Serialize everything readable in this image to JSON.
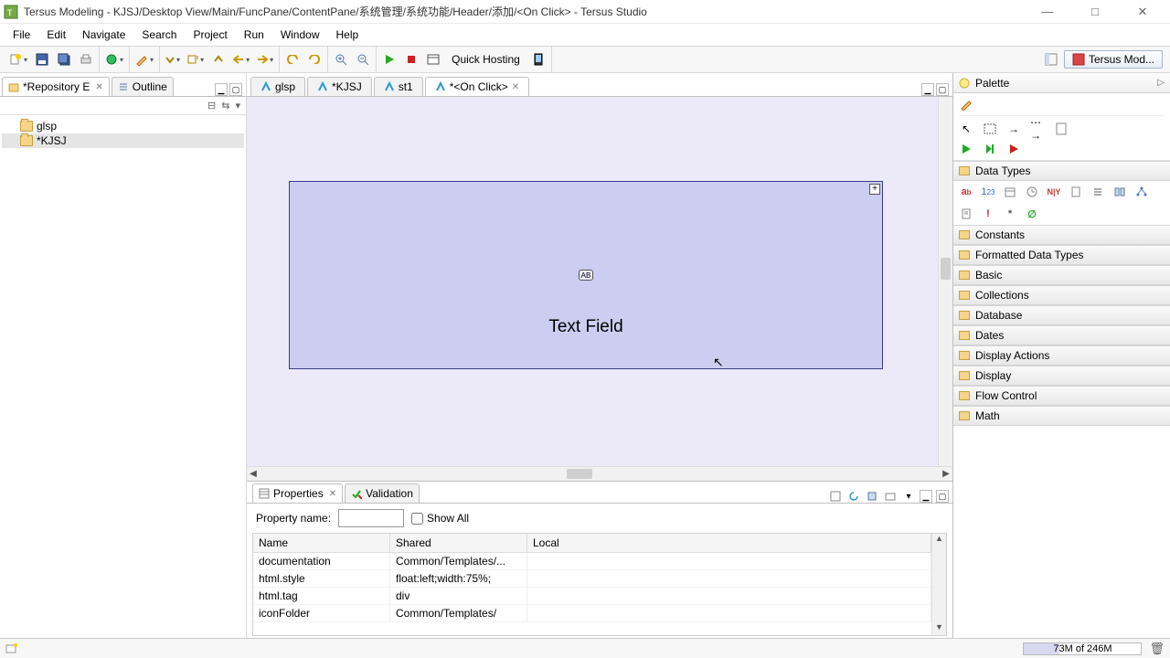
{
  "window": {
    "title": "Tersus Modeling - KJSJ/Desktop View/Main/FuncPane/ContentPane/系统管理/系统功能/Header/添加/<On Click> - Tersus Studio"
  },
  "menu": [
    "File",
    "Edit",
    "Navigate",
    "Search",
    "Project",
    "Run",
    "Window",
    "Help"
  ],
  "toolbar": {
    "quick_hosting": "Quick Hosting"
  },
  "perspective": {
    "label": "Tersus Mod..."
  },
  "leftViews": {
    "repo": "*Repository E",
    "outline": "Outline"
  },
  "tree": {
    "items": [
      "glsp",
      "*KJSJ"
    ],
    "selected": 1
  },
  "editorTabs": [
    {
      "label": "glsp",
      "active": false,
      "dirty": false
    },
    {
      "label": "*KJSJ",
      "active": false,
      "dirty": false
    },
    {
      "label": "st1",
      "active": false,
      "dirty": false
    },
    {
      "label": "*<On Click>",
      "active": true,
      "dirty": true
    }
  ],
  "canvas": {
    "badge": "AB",
    "label": "Text Field"
  },
  "palette": {
    "title": "Palette",
    "categories": [
      "Data Types",
      "Constants",
      "Formatted Data Types",
      "Basic",
      "Collections",
      "Database",
      "Dates",
      "Display Actions",
      "Display",
      "Flow Control",
      "Math"
    ]
  },
  "bottomTabs": {
    "properties": "Properties",
    "validation": "Validation"
  },
  "propsFilter": {
    "label": "Property name:",
    "value": "",
    "showAll": "Show All"
  },
  "propsTable": {
    "headers": [
      "Name",
      "Shared",
      "Local"
    ],
    "rows": [
      [
        "documentation",
        "Common/Templates/...",
        ""
      ],
      [
        "html.style",
        "float:left;width:75%;",
        ""
      ],
      [
        "html.tag",
        "div",
        ""
      ],
      [
        "iconFolder",
        "Common/Templates/",
        ""
      ]
    ]
  },
  "status": {
    "memory": "73M of 246M"
  }
}
